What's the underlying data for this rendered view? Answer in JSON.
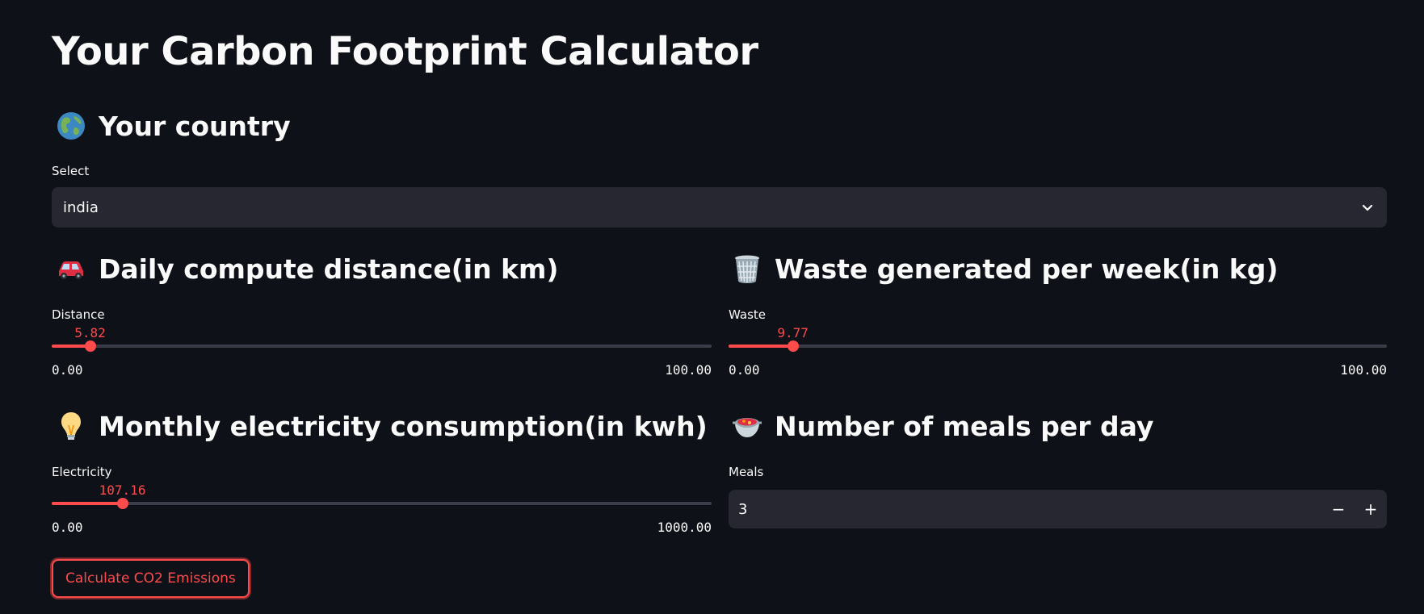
{
  "page": {
    "title": "Your Carbon Footprint Calculator"
  },
  "country": {
    "heading": "Your country",
    "icon": "globe-icon",
    "select_label": "Select",
    "selected_value": "india"
  },
  "distance": {
    "heading": "Daily compute distance(in km)",
    "icon": "car-icon",
    "label": "Distance",
    "value": "5.82",
    "min": "0.00",
    "max": "100.00",
    "value_fraction": 0.0582
  },
  "waste": {
    "heading": "Waste generated per week(in kg)",
    "icon": "wastebasket-icon",
    "label": "Waste",
    "value": "9.77",
    "min": "0.00",
    "max": "100.00",
    "value_fraction": 0.0977
  },
  "electricity": {
    "heading": "Monthly electricity consumption(in kwh)",
    "icon": "lightbulb-icon",
    "label": "Electricity",
    "value": "107.16",
    "min": "0.00",
    "max": "1000.00",
    "value_fraction": 0.10716
  },
  "meals": {
    "heading": "Number of meals per day",
    "icon": "food-pot-icon",
    "label": "Meals",
    "value": "3",
    "decrement": "−",
    "increment": "+"
  },
  "actions": {
    "calculate_label": "Calculate CO2 Emissions"
  },
  "colors": {
    "background": "#0e1117",
    "accent": "#ff4b4b",
    "input_bg": "#262730"
  }
}
